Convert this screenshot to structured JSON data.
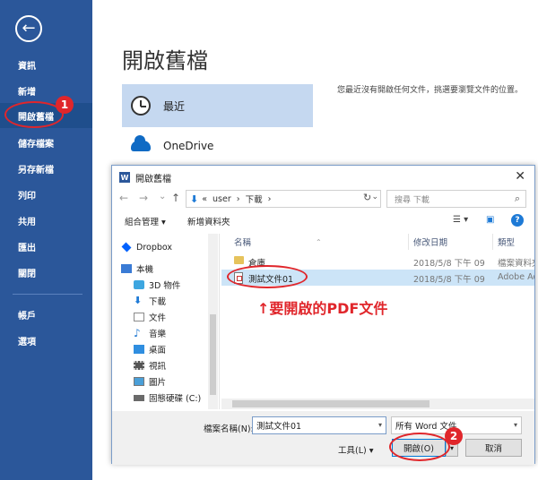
{
  "sidebar": {
    "back_symbol": "←",
    "items": [
      {
        "label": "資訊"
      },
      {
        "label": "新增"
      },
      {
        "label": "開啟舊檔"
      },
      {
        "label": "儲存檔案"
      },
      {
        "label": "另存新檔"
      },
      {
        "label": "列印"
      },
      {
        "label": "共用"
      },
      {
        "label": "匯出"
      },
      {
        "label": "關閉"
      },
      {
        "label": "帳戶"
      },
      {
        "label": "選項"
      }
    ],
    "accent": "#2b579a"
  },
  "main": {
    "title": "開啟舊檔",
    "locations": [
      {
        "label": "最近",
        "icon": "clock-icon"
      },
      {
        "label": "OneDrive",
        "icon": "cloud-icon"
      }
    ],
    "recent_message": "您最近沒有開啟任何文件，挑選要瀏覽文件的位置。"
  },
  "annotations": {
    "badge1": "1",
    "badge2": "2",
    "pdf_note": "↑要開啟的PDF文件",
    "color": "#e0262b"
  },
  "dialog": {
    "title": "開啟舊檔",
    "app_icon": "W",
    "close": "✕",
    "nav": {
      "back": "←",
      "forward": "→",
      "up_dropdown": "⌄",
      "up": "↑"
    },
    "address": {
      "prefix": "«",
      "parts": [
        "user",
        "下載"
      ],
      "sep": "›"
    },
    "search_placeholder": "搜尋 下載",
    "toolbar": {
      "organize": "組合管理 ▾",
      "new_folder": "新增資料夾",
      "help": "?"
    },
    "tree": [
      {
        "label": "Dropbox",
        "icon": "dropbox-icon",
        "color": "#0061fe"
      },
      {
        "label": "本機",
        "icon": "computer-icon",
        "color": "#3a7bd5"
      },
      {
        "label": "3D 物件",
        "icon": "3d-objects-icon",
        "color": "#3da6e0"
      },
      {
        "label": "下載",
        "icon": "download-icon",
        "color": "#1e7ad6"
      },
      {
        "label": "文件",
        "icon": "documents-icon",
        "color": "#8a8a8a"
      },
      {
        "label": "音樂",
        "icon": "music-icon",
        "color": "#2a7fd4"
      },
      {
        "label": "桌面",
        "icon": "desktop-icon",
        "color": "#2f8ee0"
      },
      {
        "label": "視訊",
        "icon": "videos-icon",
        "color": "#555555"
      },
      {
        "label": "圖片",
        "icon": "pictures-icon",
        "color": "#4a9fd8"
      },
      {
        "label": "固態硬碟 (C:)",
        "icon": "drive-icon",
        "color": "#6a6a6a"
      }
    ],
    "columns": [
      "名稱",
      "修改日期",
      "類型"
    ],
    "files": [
      {
        "name": "倉庫",
        "date": "2018/5/8 下午 09",
        "type": "檔案資料夾",
        "icon": "folder-icon"
      },
      {
        "name": "測試文件01",
        "date": "2018/5/8 下午 09",
        "type": "Adobe Ac",
        "icon": "pdf-file-icon"
      }
    ],
    "filename_label": "檔案名稱(N):",
    "filename_value": "測試文件01",
    "filetype_value": "所有 Word 文件",
    "tools_label": "工具(L) ▾",
    "open_button": "開啟(O)",
    "open_dropdown": "▾",
    "cancel_button": "取消"
  }
}
